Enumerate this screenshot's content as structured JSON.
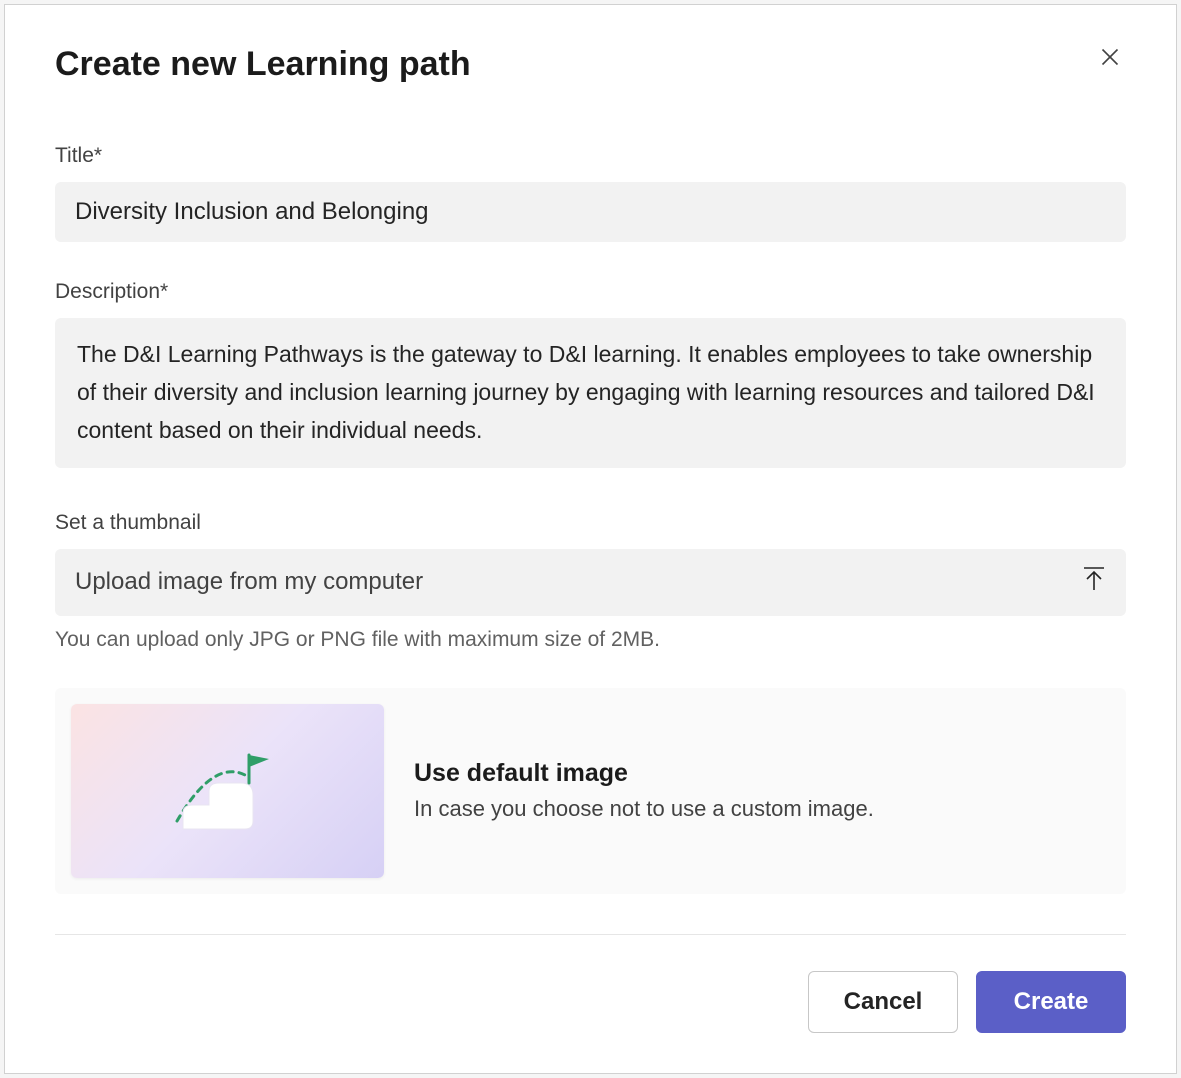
{
  "modal": {
    "title": "Create new Learning path"
  },
  "form": {
    "title_label": "Title*",
    "title_value": "Diversity Inclusion and Belonging",
    "description_label": "Description*",
    "description_value": "The D&I Learning Pathways is the gateway to D&I learning. It enables employees to take ownership of their diversity and inclusion learning journey by engaging with learning resources and tailored D&I content based on their individual needs.",
    "thumbnail_label": "Set a thumbnail",
    "upload_text": "Upload image from my computer",
    "upload_helper": "You can upload only JPG or PNG file with maximum size of 2MB.",
    "default_image_title": "Use default image",
    "default_image_sub": "In case you choose not to use a custom image."
  },
  "actions": {
    "cancel": "Cancel",
    "create": "Create"
  }
}
